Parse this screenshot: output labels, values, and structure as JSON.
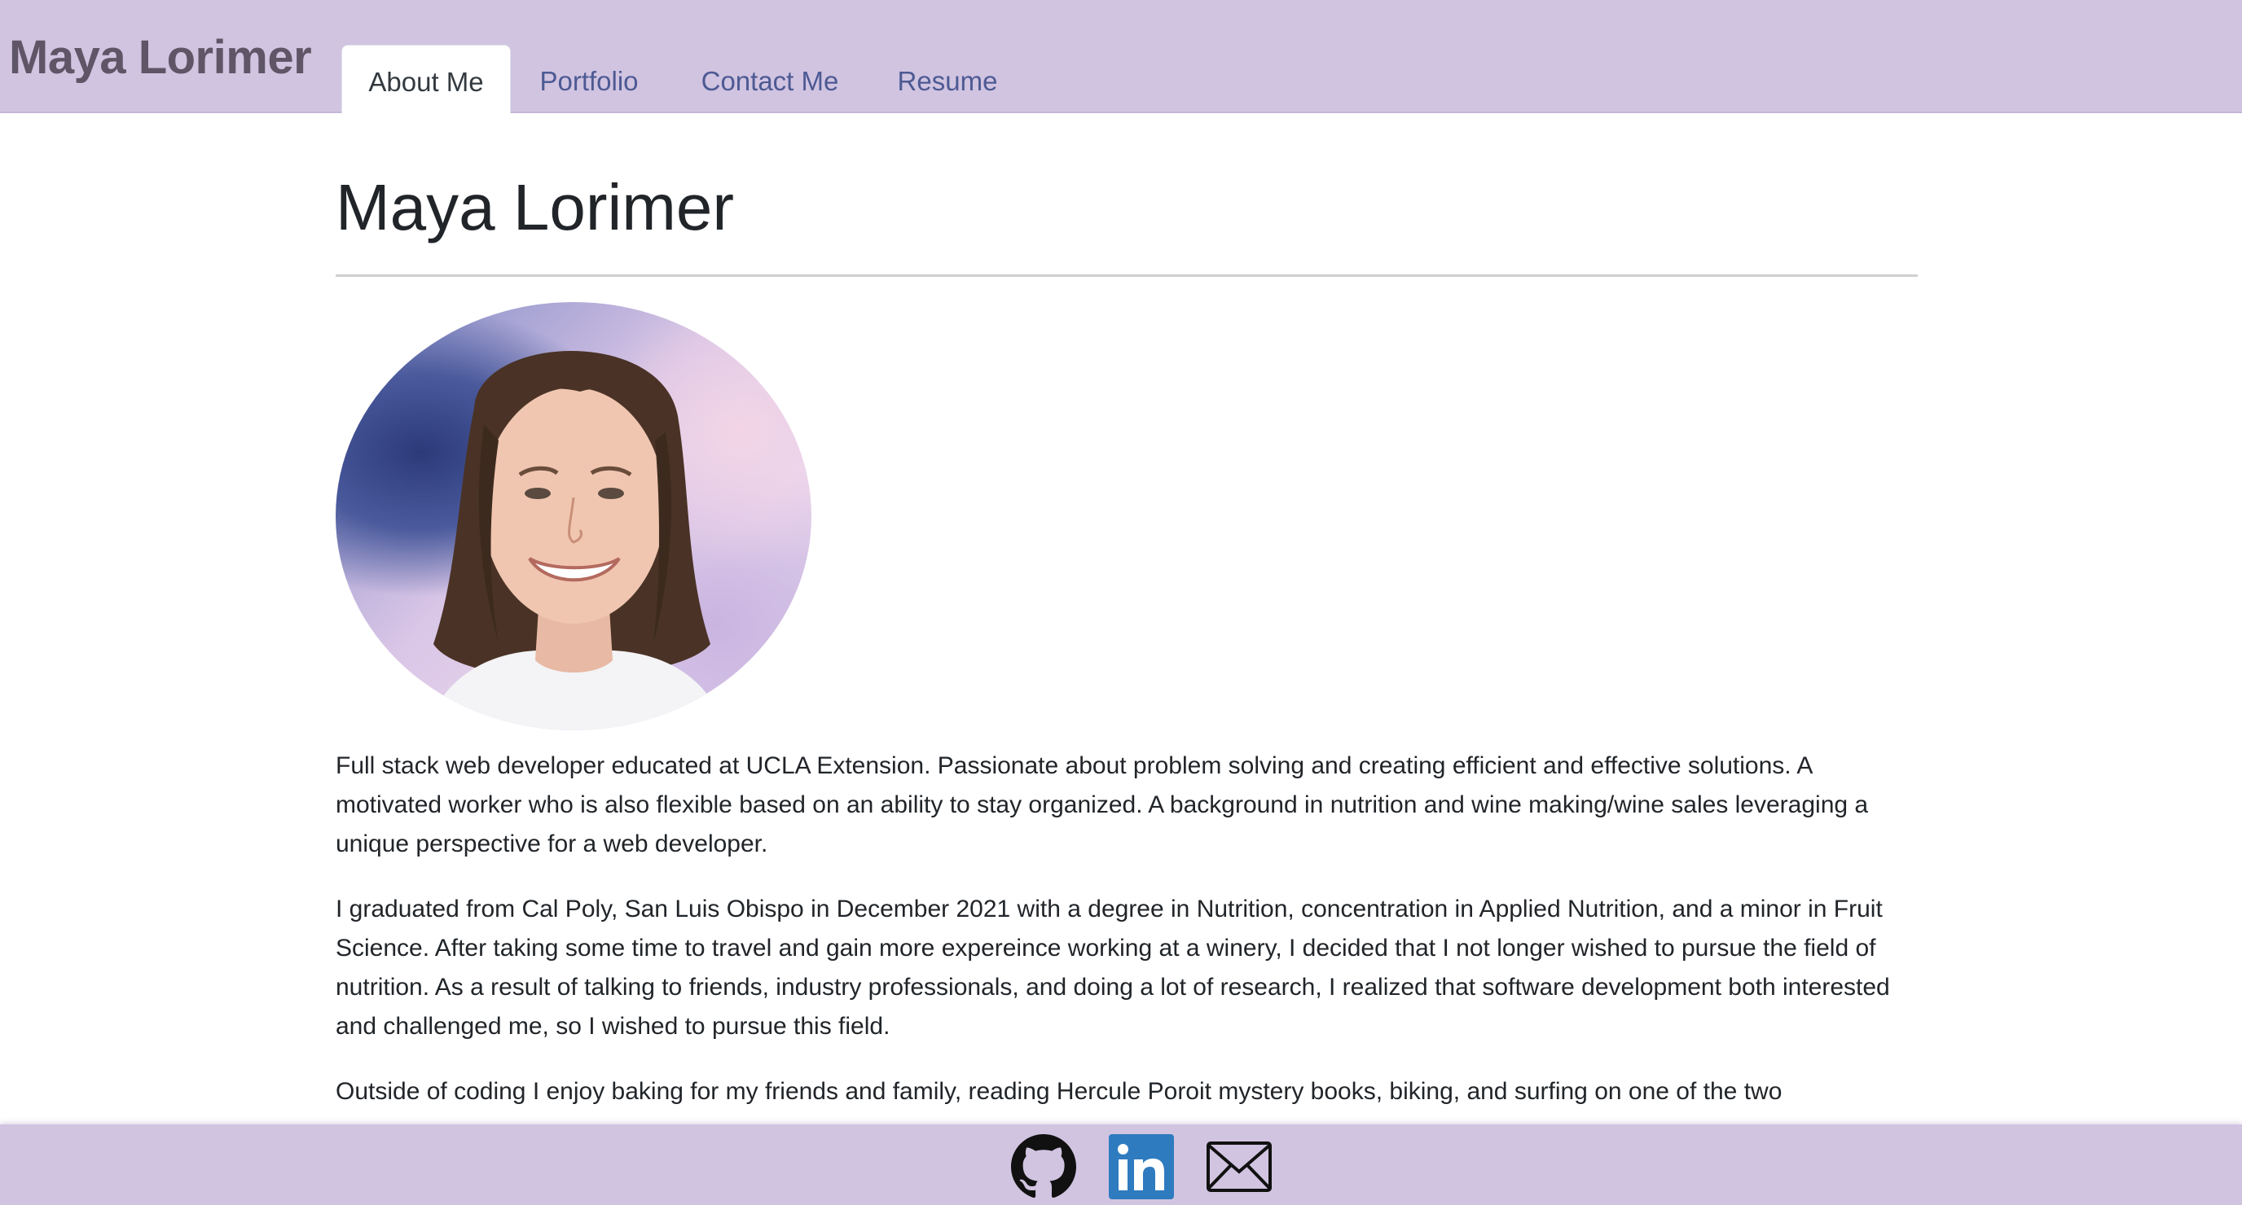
{
  "header": {
    "brand": "Maya Lorimer",
    "tabs": [
      {
        "label": "About Me",
        "active": true
      },
      {
        "label": "Portfolio",
        "active": false
      },
      {
        "label": "Contact Me",
        "active": false
      },
      {
        "label": "Resume",
        "active": false
      }
    ]
  },
  "main": {
    "title": "Maya Lorimer",
    "paragraphs": [
      "Full stack web developer educated at UCLA Extension. Passionate about problem solving and creating efficient and effective solutions. A motivated worker who is also flexible based on an ability to stay organized. A background in nutrition and wine making/wine sales leveraging a unique perspective for a web developer.",
      "I graduated from Cal Poly, San Luis Obispo in December 2021 with a degree in Nutrition, concentration in Applied Nutrition, and a minor in Fruit Science. After taking some time to travel and gain more expereince working at a winery, I decided that I not longer wished to pursue the field of nutrition. As a result of talking to friends, industry professionals, and doing a lot of research, I realized that software development both interested and challenged me, so I wished to pursue this field.",
      "Outside of coding I enjoy baking for my friends and family, reading Hercule Poroit mystery books, biking, and surfing on one of the two"
    ]
  },
  "footer": {
    "icons": [
      "github-icon",
      "linkedin-icon",
      "email-icon"
    ]
  },
  "colors": {
    "header_bg": "#d1c4e1",
    "nav_link": "#4d5a93",
    "brand_text": "#5e5566",
    "linkedin_blue": "#2f7bbf"
  }
}
